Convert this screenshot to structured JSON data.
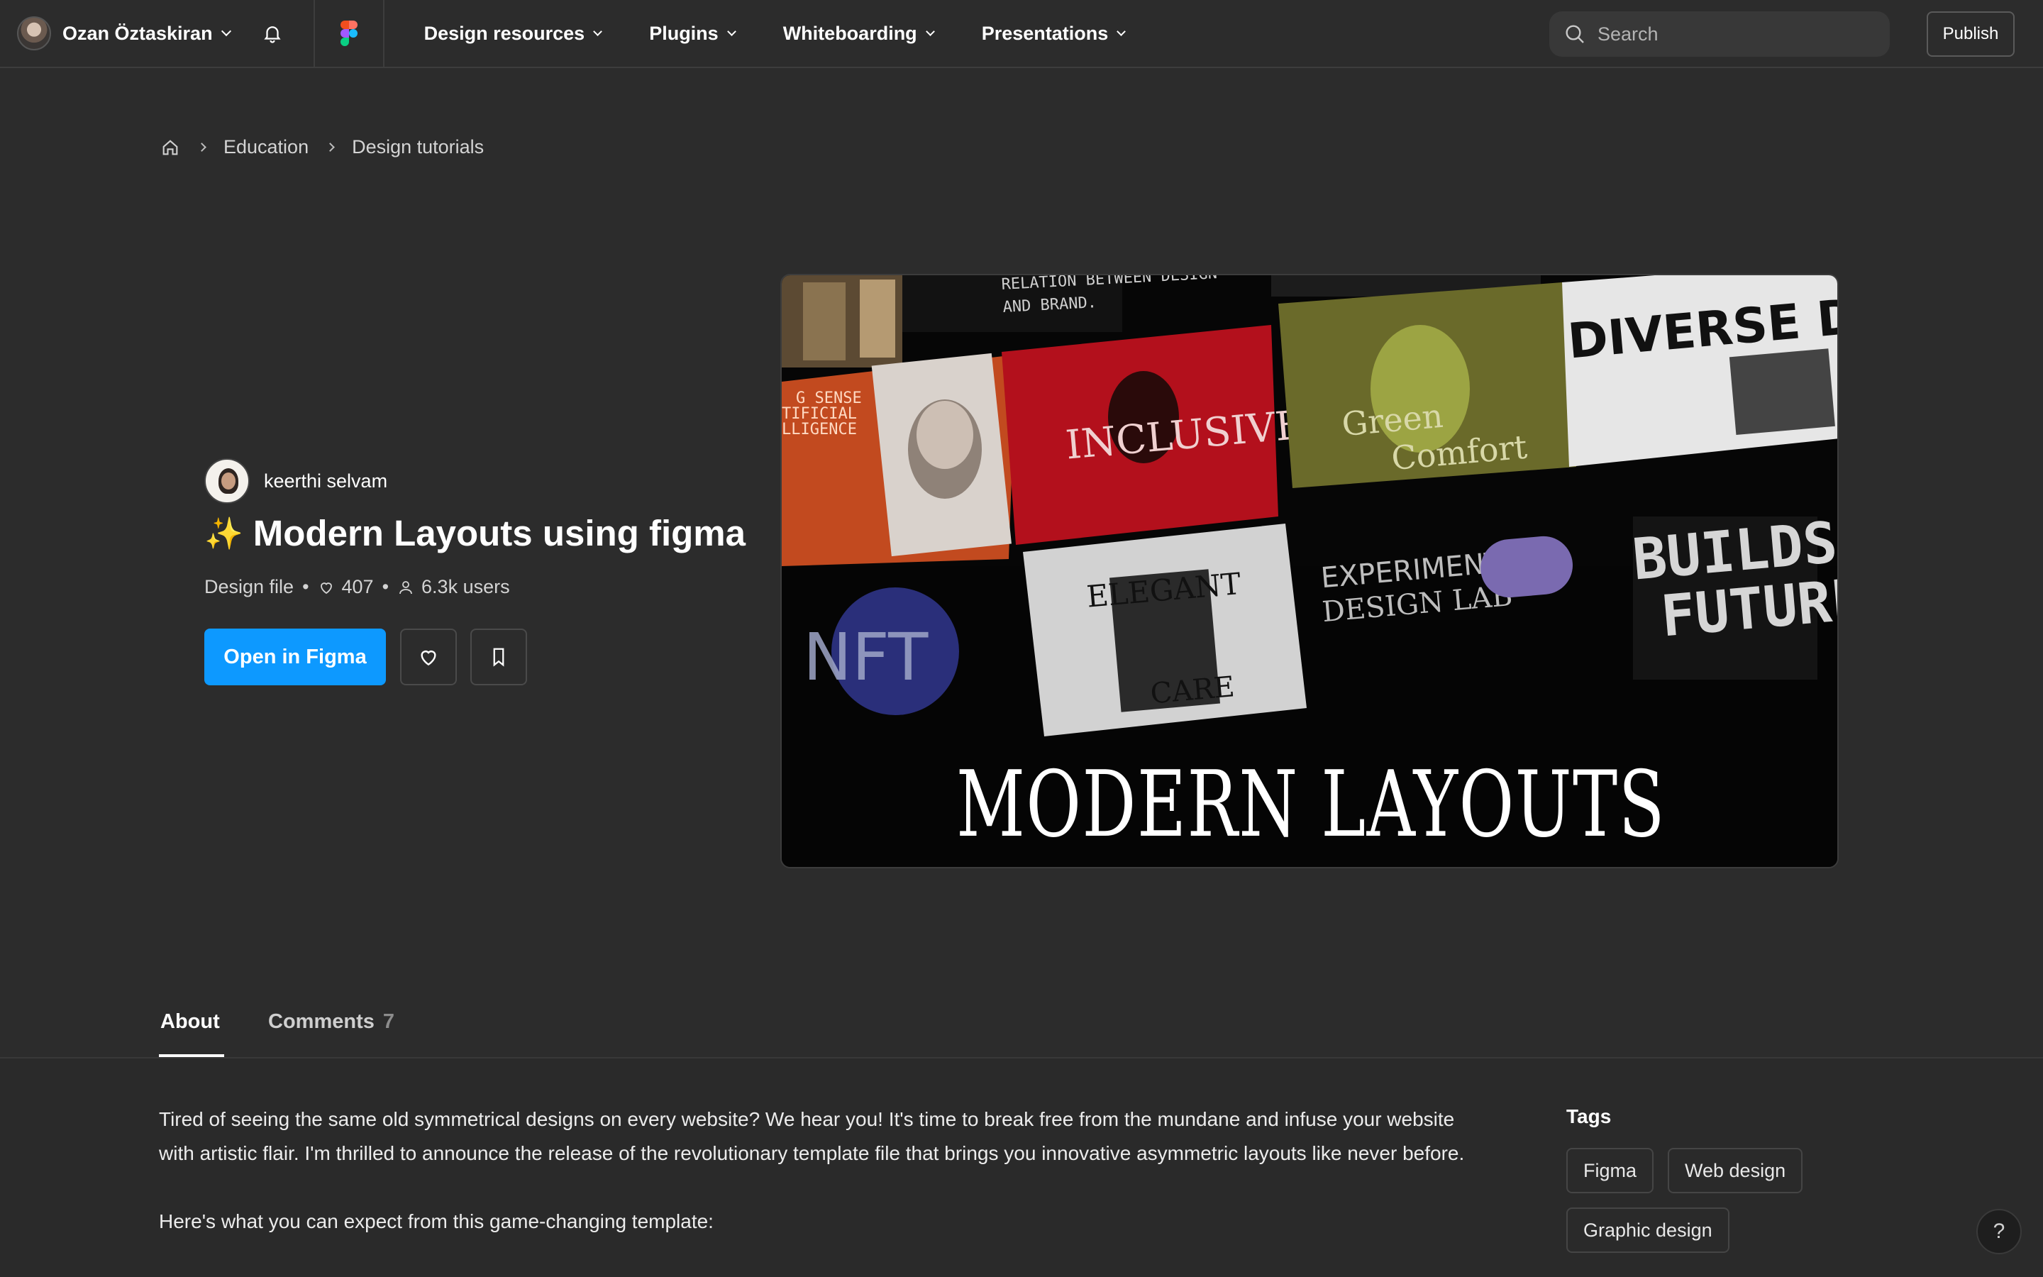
{
  "topnav": {
    "user_name": "Ozan Öztaskiran",
    "links": [
      {
        "label": "Design resources"
      },
      {
        "label": "Plugins"
      },
      {
        "label": "Whiteboarding"
      },
      {
        "label": "Presentations"
      }
    ],
    "search_placeholder": "Search",
    "publish_label": "Publish"
  },
  "breadcrumb": {
    "items": [
      "Education",
      "Design tutorials"
    ]
  },
  "file": {
    "author": "keerthi selvam",
    "sparkle": "✨",
    "title": "Modern Layouts using figma",
    "type": "Design file",
    "likes": "407",
    "users": "6.3k users",
    "open_label": "Open in Figma"
  },
  "thumbnail": {
    "big_title": "MODERN LAYOUTS",
    "panels": {
      "relation": [
        "RELATION BETWEEN DESIGN",
        "AND BRAND."
      ],
      "sense": [
        "G SENSE",
        "TIFICIAL",
        "LLIGENCE"
      ],
      "inclusive": "INCLUSIVE",
      "green": "Green",
      "comfort": "Comfort",
      "diverse": "DIVERSE DESIGN",
      "elegant": "ELEGANT",
      "care": "CARE",
      "experiment": "EXPERIMENT",
      "lab": "DESIGN LAB",
      "builds": "BUILDS",
      "future": "FUTURE",
      "nft": "NFT"
    }
  },
  "tabs": {
    "about": "About",
    "comments": "Comments",
    "comments_count": "7"
  },
  "about": {
    "paragraph1": "Tired of seeing the same old symmetrical designs on every website? We hear you! It's time to break free from the mundane and infuse your website with artistic flair. I'm thrilled to announce the release of the revolutionary template file that brings you innovative asymmetric layouts like never before.",
    "paragraph2": "Here's what you can expect from this game-changing template:"
  },
  "tags": {
    "title": "Tags",
    "items": [
      "Figma",
      "Web design",
      "Graphic design"
    ]
  },
  "help_label": "?",
  "colors": {
    "background": "#2c2c2c",
    "accent": "#0d99ff",
    "text": "#ffffff"
  }
}
